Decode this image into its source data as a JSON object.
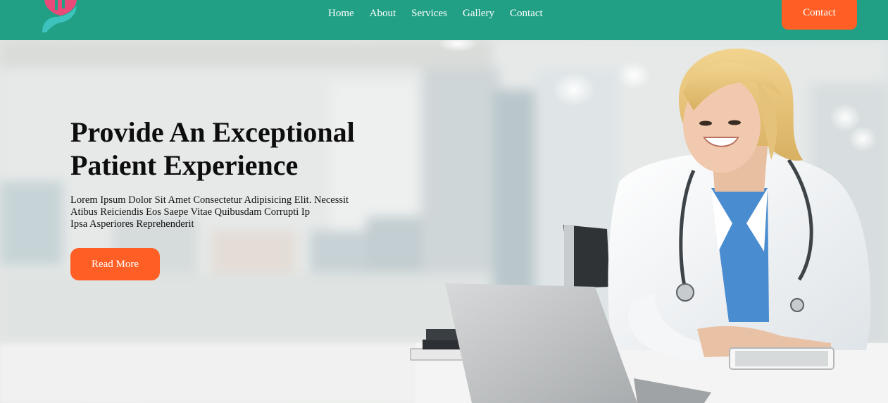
{
  "nav": {
    "items": [
      {
        "label": "Home"
      },
      {
        "label": "About"
      },
      {
        "label": "Services"
      },
      {
        "label": "Gallery"
      },
      {
        "label": "Contact"
      }
    ],
    "contact_button": "Contact"
  },
  "hero": {
    "title_line1": "Provide An Exceptional",
    "title_line2": "Patient Experience",
    "text_line1": "Lorem Ipsum Dolor Sit Amet Consectetur Adipisicing Elit. Necessit",
    "text_line2": "Atibus Reiciendis Eos Saepe Vitae Quibusdam Corrupti Ip",
    "text_line3": "Ipsa Asperiores Reprehenderit",
    "read_more": "Read More"
  },
  "colors": {
    "header_bg": "#21a085",
    "accent": "#ff5f24",
    "logo_pink": "#ea4a7a",
    "logo_teal": "#3ec2be"
  },
  "icons": {
    "logo": "heart-in-hand-logo-icon"
  }
}
